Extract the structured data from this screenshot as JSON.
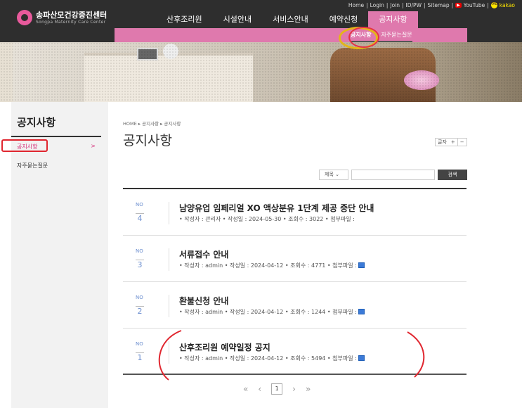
{
  "header": {
    "logo_title": "송파산모건강증진센터",
    "logo_sub": "Songpa Maternity Care Center",
    "util": [
      "Home",
      "Login",
      "Join",
      "ID/PW",
      "Sitemap",
      "YouTube",
      "kakao"
    ],
    "gnb": [
      "산후조리원",
      "시설안내",
      "서비스안내",
      "예약신청",
      "공지사항"
    ],
    "sub": [
      "공지사항",
      "자주묻는질문"
    ]
  },
  "side": {
    "title": "공지사항",
    "items": [
      "공지사항",
      "자주묻는질문"
    ],
    "chevron": ">"
  },
  "main": {
    "breadcrumb": "HOME ▸ 공지사항 ▸ 공지사항",
    "title": "공지사항",
    "font_label": "글자",
    "font_plus": "+",
    "font_minus": "−",
    "search_select": "제목",
    "search_btn": "검색",
    "no_label": "NO",
    "posts": [
      {
        "no": "4",
        "title": "남양유업 임페리얼 XO 액상분유 1단계 제공 중단 안내",
        "meta": "• 작성자 : 관리자   • 작성일 : 2024-05-30   • 조회수 : 3022   • 첨부파일 :",
        "file": false
      },
      {
        "no": "3",
        "title": "서류접수 안내",
        "meta": "• 작성자 : admin   • 작성일 : 2024-04-12   • 조회수 : 4771   • 첨부파일 :",
        "file": true
      },
      {
        "no": "2",
        "title": "환불신청 안내",
        "meta": "• 작성자 : admin   • 작성일 : 2024-04-12   • 조회수 : 1244   • 첨부파일 :",
        "file": true
      },
      {
        "no": "1",
        "title": "산후조리원 예약일정 공지",
        "meta": "• 작성자 : admin   • 작성일 : 2024-04-12   • 조회수 : 5494   • 첨부파일 :",
        "file": true
      }
    ],
    "pager": {
      "first": "«",
      "prev": "‹",
      "current": "1",
      "next": "›",
      "last": "»"
    }
  },
  "colors": {
    "accent": "#df79ad",
    "annotation_red": "#e0262f",
    "annotation_yellow": "#e5b519"
  }
}
